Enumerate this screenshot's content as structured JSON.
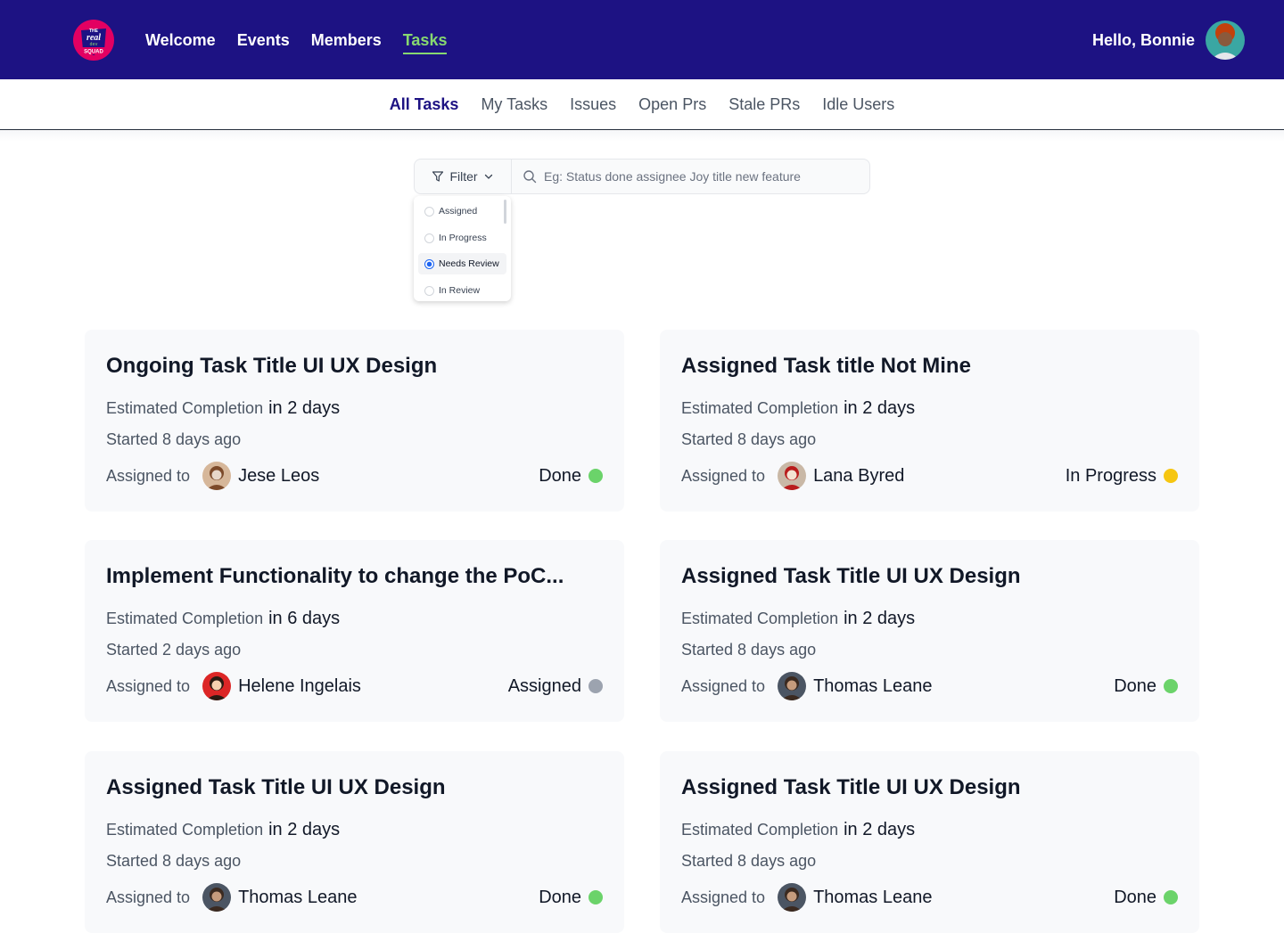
{
  "header": {
    "logo_lines": [
      "THE",
      "real",
      "dev",
      "SQUAD"
    ],
    "nav": [
      {
        "label": "Welcome"
      },
      {
        "label": "Events"
      },
      {
        "label": "Members"
      },
      {
        "label": "Tasks",
        "active": true
      }
    ],
    "greeting": "Hello, Bonnie"
  },
  "subnav": {
    "tabs": [
      "All Tasks",
      "My Tasks",
      "Issues",
      "Open Prs",
      "Stale PRs",
      "Idle Users"
    ],
    "active": "All Tasks"
  },
  "filter": {
    "button_label": "Filter",
    "search_placeholder": "Eg: Status done assignee Joy title new feature",
    "options": [
      {
        "label": "Assigned",
        "checked": false
      },
      {
        "label": "In Progress",
        "checked": false
      },
      {
        "label": "Needs Review",
        "checked": true
      },
      {
        "label": "In Review",
        "checked": false
      }
    ]
  },
  "labels": {
    "estimated": "Estimated Completion",
    "assigned_to": "Assigned to"
  },
  "status_colors": {
    "Done": "#6bd36a",
    "In Progress": "#f6c611",
    "Assigned": "#9ca3af"
  },
  "tasks": [
    {
      "title": "Ongoing Task Title UI UX Design",
      "eta": "in 2 days",
      "started": "Started 8 days ago",
      "assignee": "Jese Leos",
      "status": "Done"
    },
    {
      "title": "Assigned Task title Not Mine",
      "eta": "in 2 days",
      "started": "Started 8 days ago",
      "assignee": "Lana Byred",
      "status": "In Progress"
    },
    {
      "title": "Implement Functionality to change the PoC...",
      "eta": "in 6 days",
      "started": "Started 2 days ago",
      "assignee": "Helene Ingelais",
      "status": "Assigned"
    },
    {
      "title": "Assigned Task Title UI UX Design",
      "eta": "in 2 days",
      "started": "Started 8 days ago",
      "assignee": "Thomas Leane",
      "status": "Done"
    },
    {
      "title": "Assigned Task Title UI UX Design",
      "eta": "in 2 days",
      "started": "Started 8 days ago",
      "assignee": "Thomas Leane",
      "status": "Done"
    },
    {
      "title": "Assigned Task Title UI UX Design",
      "eta": "in 2 days",
      "started": "Started 8 days ago",
      "assignee": "Thomas Leane",
      "status": "Done"
    }
  ]
}
